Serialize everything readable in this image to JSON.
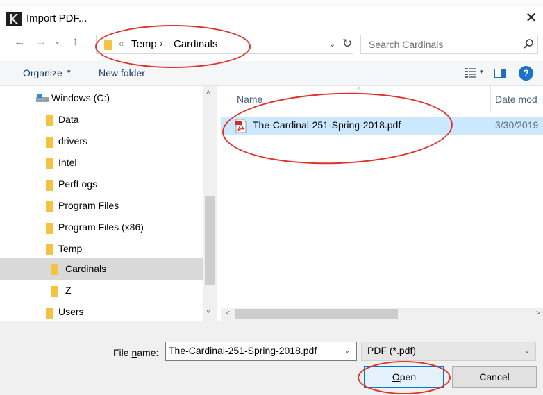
{
  "window": {
    "title": "Import PDF...",
    "close_glyph": "✕",
    "app_icon": "app-icon"
  },
  "address": {
    "back_glyph": "←",
    "forward_glyph": "→",
    "recent_glyph": "⌄",
    "up_glyph": "↑",
    "separator_glyph": "«",
    "breadcrumb": [
      "Temp",
      "Cardinals"
    ],
    "breadcrumb_arrow": "›",
    "dropdown_glyph": "⌄",
    "refresh_glyph": "↻"
  },
  "search": {
    "placeholder": "Search Cardinals"
  },
  "toolbar": {
    "organize_label": "Organize",
    "organize_caret": "▾",
    "new_folder_label": "New folder",
    "view_caret": "▾",
    "help_label": "?"
  },
  "nav": {
    "items": [
      {
        "label": "Windows (C:)",
        "icon": "drive-icon",
        "indent": 0,
        "selected": false
      },
      {
        "label": "Data",
        "icon": "folder-icon",
        "indent": 1,
        "selected": false
      },
      {
        "label": "drivers",
        "icon": "folder-icon",
        "indent": 1,
        "selected": false
      },
      {
        "label": "Intel",
        "icon": "folder-icon",
        "indent": 1,
        "selected": false
      },
      {
        "label": "PerfLogs",
        "icon": "folder-icon",
        "indent": 1,
        "selected": false
      },
      {
        "label": "Program Files",
        "icon": "folder-icon",
        "indent": 1,
        "selected": false
      },
      {
        "label": "Program Files (x86)",
        "icon": "folder-icon",
        "indent": 1,
        "selected": false
      },
      {
        "label": "Temp",
        "icon": "folder-icon",
        "indent": 1,
        "selected": false
      },
      {
        "label": "Cardinals",
        "icon": "folder-icon",
        "indent": 2,
        "selected": true
      },
      {
        "label": "Z",
        "icon": "folder-icon",
        "indent": 2,
        "selected": false
      },
      {
        "label": "Users",
        "icon": "folder-icon",
        "indent": 1,
        "selected": false
      }
    ],
    "scroll_up_glyph": "˄",
    "scroll_down_glyph": "˅"
  },
  "filelist": {
    "columns": {
      "name": "Name",
      "date": "Date mod",
      "sort_glyph": "^"
    },
    "files": [
      {
        "name": "The-Cardinal-251-Spring-2018.pdf",
        "date": "3/30/2019",
        "icon": "pdf-icon",
        "selected": true
      }
    ],
    "hscroll_left_glyph": "<",
    "hscroll_right_glyph": ">"
  },
  "bottom": {
    "file_name_label_pre": "File ",
    "file_name_label_accel": "n",
    "file_name_label_post": "ame:",
    "file_name_value": "The-Cardinal-251-Spring-2018.pdf",
    "file_name_drop_glyph": "⌄",
    "filter_value": "PDF (*.pdf)",
    "filter_drop_glyph": "⌄",
    "open_accel": "O",
    "open_rest": "pen",
    "cancel_label": "Cancel"
  },
  "colors": {
    "annotation": "#e0302a",
    "selection": "#cce8ff",
    "accent": "#0078d7",
    "folder": "#f5c242"
  }
}
